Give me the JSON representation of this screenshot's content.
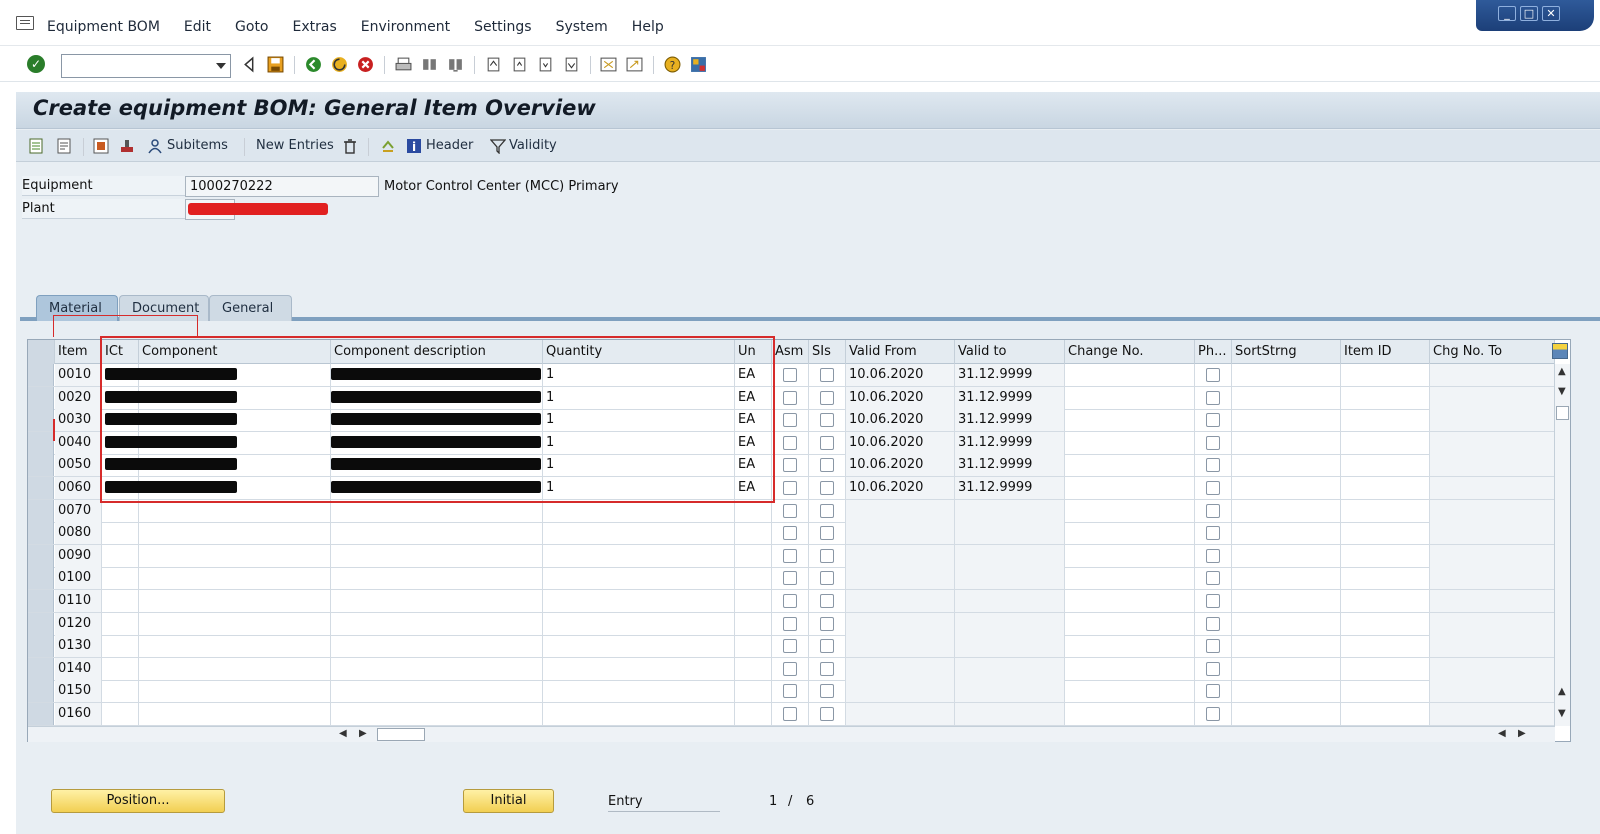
{
  "menu": [
    "Equipment BOM",
    "Edit",
    "Goto",
    "Extras",
    "Environment",
    "Settings",
    "System",
    "Help"
  ],
  "window_controls": [
    "_",
    "□",
    "✕"
  ],
  "command_field": {
    "value": ""
  },
  "title": "Create equipment BOM: General Item Overview",
  "app_toolbar": {
    "subitems": "Subitems",
    "new_entries": "New Entries",
    "header": "Header",
    "validity": "Validity"
  },
  "header": {
    "equipment_label": "Equipment",
    "equipment_value": "1000270222",
    "equipment_desc": "Motor Control Center (MCC) Primary",
    "plant_label": "Plant"
  },
  "tabs": [
    "Material",
    "Document",
    "General"
  ],
  "table": {
    "columns": [
      "Item",
      "ICt",
      "Component",
      "Component description",
      "Quantity",
      "Un",
      "Asm",
      "SIs",
      "Valid From",
      "Valid to",
      "Change No.",
      "Ph...",
      "SortStrng",
      "Item ID",
      "Chg No. To"
    ],
    "rows": [
      {
        "item": "0010",
        "qty": "1",
        "un": "EA",
        "from": "10.06.2020",
        "to": "31.12.9999",
        "filled": true
      },
      {
        "item": "0020",
        "qty": "1",
        "un": "EA",
        "from": "10.06.2020",
        "to": "31.12.9999",
        "filled": true
      },
      {
        "item": "0030",
        "qty": "1",
        "un": "EA",
        "from": "10.06.2020",
        "to": "31.12.9999",
        "filled": true
      },
      {
        "item": "0040",
        "qty": "1",
        "un": "EA",
        "from": "10.06.2020",
        "to": "31.12.9999",
        "filled": true
      },
      {
        "item": "0050",
        "qty": "1",
        "un": "EA",
        "from": "10.06.2020",
        "to": "31.12.9999",
        "filled": true
      },
      {
        "item": "0060",
        "qty": "1",
        "un": "EA",
        "from": "10.06.2020",
        "to": "31.12.9999",
        "filled": true
      },
      {
        "item": "0070",
        "qty": "",
        "un": "",
        "from": "",
        "to": "",
        "filled": false
      },
      {
        "item": "0080",
        "qty": "",
        "un": "",
        "from": "",
        "to": "",
        "filled": false
      },
      {
        "item": "0090",
        "qty": "",
        "un": "",
        "from": "",
        "to": "",
        "filled": false
      },
      {
        "item": "0100",
        "qty": "",
        "un": "",
        "from": "",
        "to": "",
        "filled": false
      },
      {
        "item": "0110",
        "qty": "",
        "un": "",
        "from": "",
        "to": "",
        "filled": false
      },
      {
        "item": "0120",
        "qty": "",
        "un": "",
        "from": "",
        "to": "",
        "filled": false
      },
      {
        "item": "0130",
        "qty": "",
        "un": "",
        "from": "",
        "to": "",
        "filled": false
      },
      {
        "item": "0140",
        "qty": "",
        "un": "",
        "from": "",
        "to": "",
        "filled": false
      },
      {
        "item": "0150",
        "qty": "",
        "un": "",
        "from": "",
        "to": "",
        "filled": false
      },
      {
        "item": "0160",
        "qty": "",
        "un": "",
        "from": "",
        "to": "",
        "filled": false
      }
    ]
  },
  "footer": {
    "position_btn": "Position...",
    "initial_btn": "Initial",
    "entry_label": "Entry",
    "page_current": "1",
    "page_sep": "/",
    "page_total": "6"
  },
  "colors": {
    "accent": "#7fa0bf",
    "title_bg": "#c9d6e2",
    "redaction_red": "#e12020",
    "highlight_box": "#d62b2b"
  }
}
